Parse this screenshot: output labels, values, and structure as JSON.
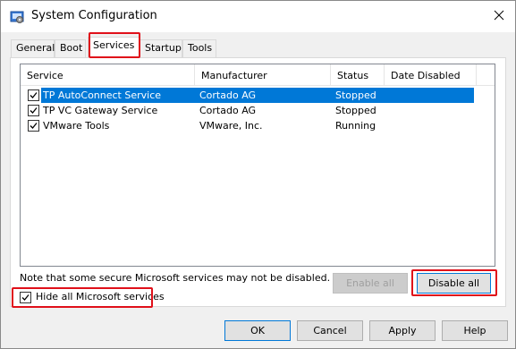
{
  "window": {
    "title": "System Configuration",
    "icons": {
      "app": "system-config-icon",
      "close": "close-icon"
    }
  },
  "tabs": [
    {
      "label": "General",
      "active": false
    },
    {
      "label": "Boot",
      "active": false
    },
    {
      "label": "Services",
      "active": true
    },
    {
      "label": "Startup",
      "active": false
    },
    {
      "label": "Tools",
      "active": false
    }
  ],
  "services_list": {
    "columns": [
      "Service",
      "Manufacturer",
      "Status",
      "Date Disabled"
    ],
    "rows": [
      {
        "checked": true,
        "service": "TP AutoConnect Service",
        "manufacturer": "Cortado AG",
        "status": "Stopped",
        "date_disabled": "",
        "selected": true
      },
      {
        "checked": true,
        "service": "TP VC Gateway Service",
        "manufacturer": "Cortado AG",
        "status": "Stopped",
        "date_disabled": "",
        "selected": false
      },
      {
        "checked": true,
        "service": "VMware Tools",
        "manufacturer": "VMware, Inc.",
        "status": "Running",
        "date_disabled": "",
        "selected": false
      }
    ]
  },
  "note": "Note that some secure Microsoft services may not be disabled.",
  "actions": {
    "enable_all": "Enable all",
    "disable_all": "Disable all"
  },
  "hide_ms": {
    "label": "Hide all Microsoft services",
    "checked": true
  },
  "footer": {
    "ok": "OK",
    "cancel": "Cancel",
    "apply": "Apply",
    "help": "Help"
  },
  "colors": {
    "selection": "#0078d7",
    "highlight_box": "#e0101a",
    "window_bg": "#f0f0f0"
  }
}
